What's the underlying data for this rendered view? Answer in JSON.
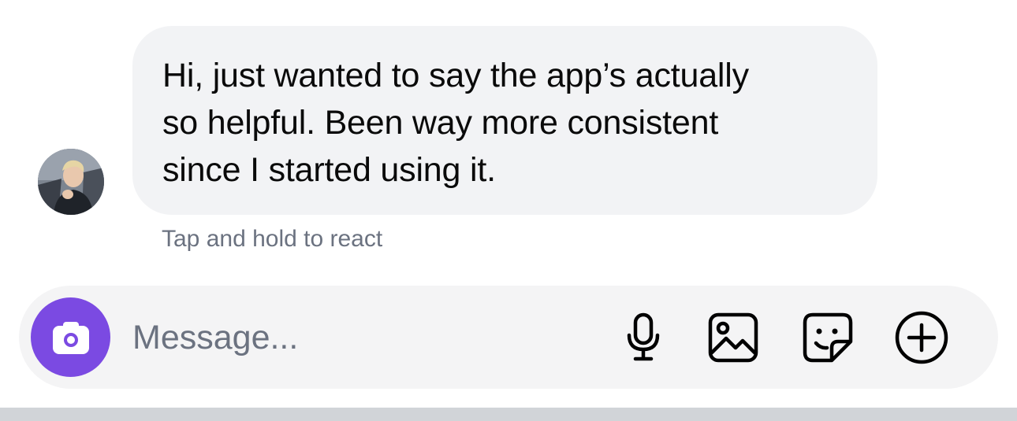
{
  "conversation": {
    "message": {
      "lines": [
        "Hi, just wanted to say the app’s actually",
        "so helpful. Been way more consistent",
        "since I started using it."
      ],
      "bubble_color": "#f2f3f5"
    },
    "react_hint": "Tap and hold to react"
  },
  "composer": {
    "placeholder": "Message...",
    "camera_button_color": "#7b4ae2",
    "icons": [
      "camera-icon",
      "microphone-icon",
      "gallery-icon",
      "sticker-icon",
      "plus-circle-icon"
    ]
  },
  "colors": {
    "hint_text": "#6b7280",
    "composer_background": "#f4f4f5",
    "bottom_bar": "#d1d4d8"
  }
}
